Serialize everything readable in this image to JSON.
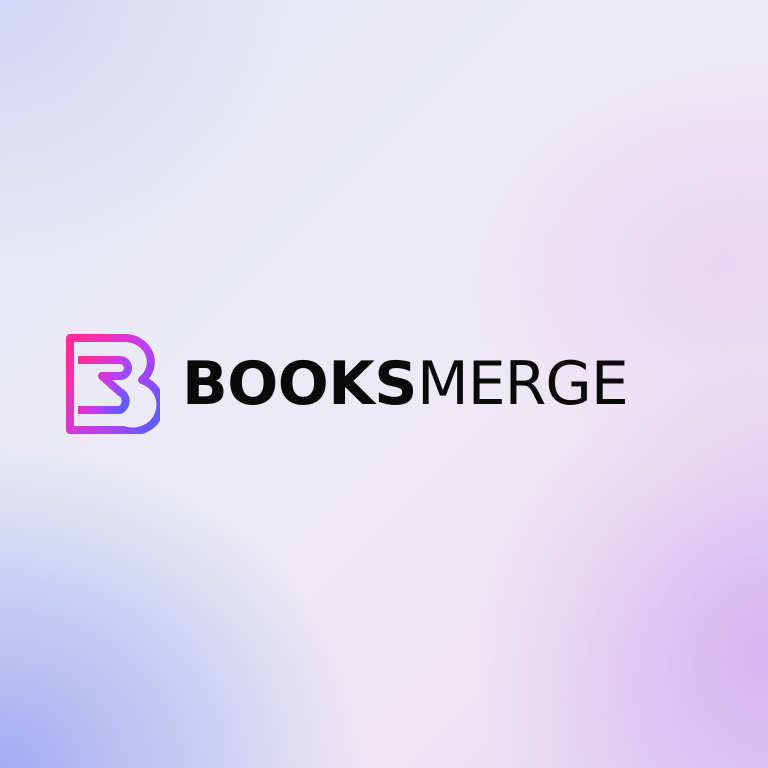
{
  "brand": {
    "name_bold": "BOOKS",
    "name_light": "MERGE",
    "logo_icon": "booksmerge-b-logo-icon",
    "colors": {
      "logo_gradient_start": "#ff2d9a",
      "logo_gradient_mid": "#c23cf0",
      "logo_gradient_end": "#5f5cff",
      "wordmark": "#0a0a0a"
    }
  }
}
